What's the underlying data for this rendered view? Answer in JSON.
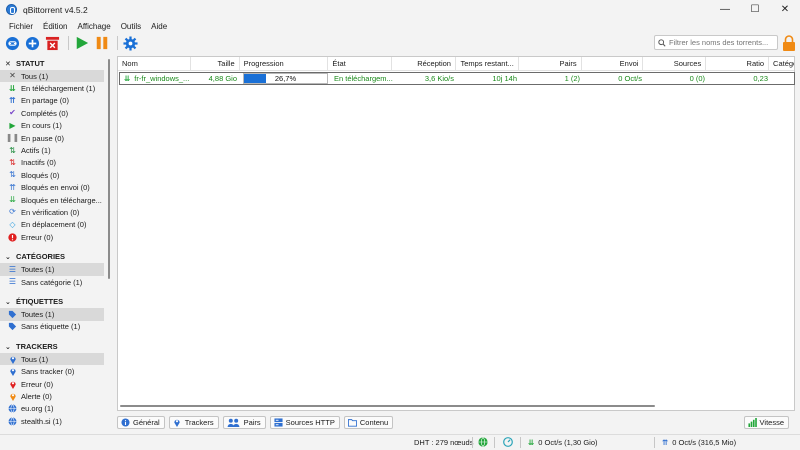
{
  "window": {
    "title": "qBittorrent v4.5.2",
    "controls": {
      "minimize": "—",
      "maximize": "☐",
      "close": "✕"
    }
  },
  "menu": [
    "Fichier",
    "Édition",
    "Affichage",
    "Outils",
    "Aide"
  ],
  "toolbar": {
    "buttons": [
      "link-icon",
      "add-icon",
      "delete-icon",
      "play-icon",
      "pause-icon",
      "gear-icon"
    ],
    "search_placeholder": "Filtrer les noms des torrents..."
  },
  "sidebar": {
    "statut": {
      "header": "STATUT",
      "items": [
        {
          "label": "Tous (1)",
          "icon": "filter-icon",
          "selected": true
        },
        {
          "label": "En téléchargement (1)",
          "icon": "download-icon"
        },
        {
          "label": "En partage (0)",
          "icon": "upload-icon"
        },
        {
          "label": "Complétés (0)",
          "icon": "check-icon"
        },
        {
          "label": "En cours (1)",
          "icon": "play-icon"
        },
        {
          "label": "En pause (0)",
          "icon": "pause-icon"
        },
        {
          "label": "Actifs (1)",
          "icon": "active-icon"
        },
        {
          "label": "Inactifs (0)",
          "icon": "inactive-icon"
        },
        {
          "label": "Bloqués (0)",
          "icon": "stalled-icon"
        },
        {
          "label": "Bloqués en envoi (0)",
          "icon": "stalled-upload-icon"
        },
        {
          "label": "Bloqués en télécharge...",
          "icon": "stalled-download-icon"
        },
        {
          "label": "En vérification (0)",
          "icon": "checking-icon"
        },
        {
          "label": "En déplacement (0)",
          "icon": "moving-icon"
        },
        {
          "label": "Erreur (0)",
          "icon": "error-icon"
        }
      ]
    },
    "categories": {
      "header": "CATÉGORIES",
      "items": [
        {
          "label": "Toutes (1)",
          "icon": "list-icon",
          "selected": true
        },
        {
          "label": "Sans catégorie (1)",
          "icon": "list-icon"
        }
      ]
    },
    "etiquettes": {
      "header": "ÉTIQUETTES",
      "items": [
        {
          "label": "Toutes (1)",
          "icon": "tag-icon",
          "selected": true
        },
        {
          "label": "Sans étiquette (1)",
          "icon": "tag-icon"
        }
      ]
    },
    "trackers": {
      "header": "TRACKERS",
      "items": [
        {
          "label": "Tous (1)",
          "icon": "pin-icon",
          "selected": true
        },
        {
          "label": "Sans tracker (0)",
          "icon": "pin-icon"
        },
        {
          "label": "Erreur (0)",
          "icon": "pin-red-icon"
        },
        {
          "label": "Alerte (0)",
          "icon": "pin-orange-icon"
        },
        {
          "label": "eu.org (1)",
          "icon": "globe-icon"
        },
        {
          "label": "stealth.si (1)",
          "icon": "globe-icon"
        }
      ]
    }
  },
  "table": {
    "columns": [
      "Nom",
      "Taille",
      "Progression",
      "État",
      "Réception",
      "Temps restant...",
      "Pairs",
      "Envoi",
      "Sources",
      "Ratio",
      "Catégor"
    ],
    "rows": [
      {
        "name": "fr-fr_windows_...",
        "size": "4,88 Gio",
        "progress_text": "26,7%",
        "progress_value": 0.267,
        "state": "En téléchargem...",
        "down": "3,6 Kio/s",
        "eta": "10j 14h",
        "peers": "1 (2)",
        "up": "0 Oct/s",
        "seeds": "0 (0)",
        "ratio": "0,23"
      }
    ]
  },
  "bottom_tabs": [
    {
      "label": "Général",
      "icon": "info-icon"
    },
    {
      "label": "Trackers",
      "icon": "pin-icon"
    },
    {
      "label": "Pairs",
      "icon": "peers-icon"
    },
    {
      "label": "Sources HTTP",
      "icon": "server-icon"
    },
    {
      "label": "Contenu",
      "icon": "folder-icon"
    }
  ],
  "speed_button": "Vitesse",
  "status": {
    "dht": "DHT : 279 nœuds",
    "download": "0 Oct/s (1,30 Gio)",
    "upload": "0 Oct/s (316,5 Mio)"
  },
  "colors": {
    "accent": "#1a70d6",
    "downloading_text": "#1a8a1a",
    "error": "#e02020"
  }
}
